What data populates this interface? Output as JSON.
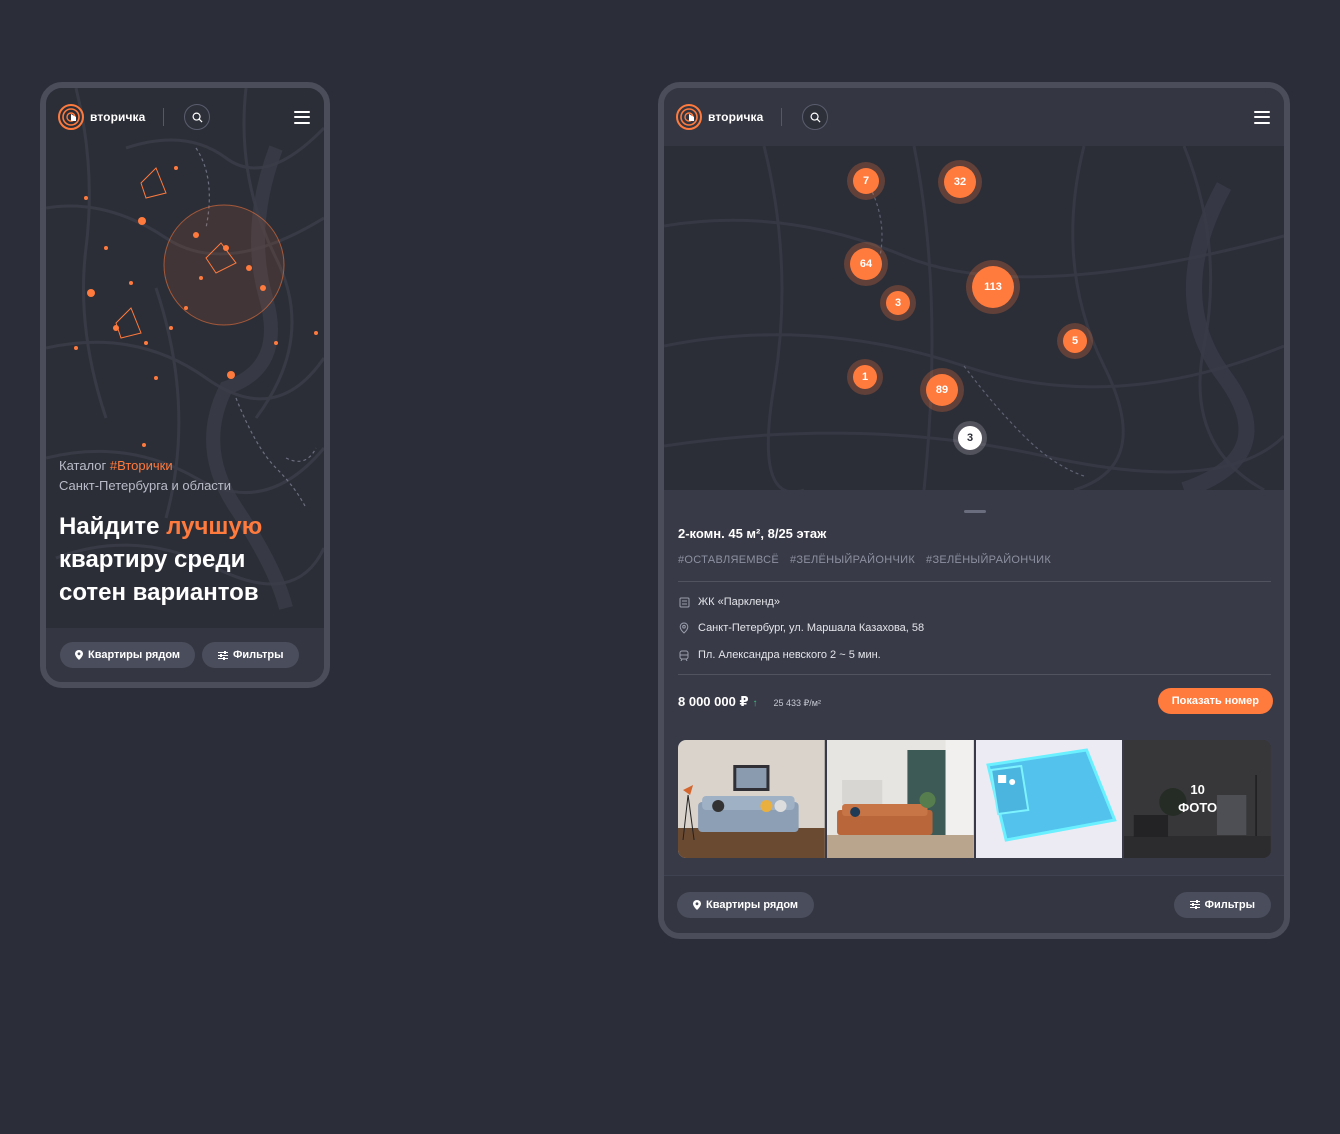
{
  "brand": {
    "name": "вторичка",
    "accent": "#ff7a3d"
  },
  "left_screen": {
    "hero_sub_prefix": "Каталог ",
    "hero_sub_accent": "#Вторички",
    "hero_sub_line2": "Санкт-Петербурга и области",
    "hero_title_pre": "Найдите ",
    "hero_title_accent": "лучшую",
    "hero_title_line2": "квартиру среди",
    "hero_title_line3": "сотен вариантов",
    "btn_nearby": "Квартиры рядом",
    "btn_filters": "Фильтры"
  },
  "right_screen": {
    "clusters": [
      {
        "label": "7"
      },
      {
        "label": "32"
      },
      {
        "label": "64"
      },
      {
        "label": "3"
      },
      {
        "label": "113"
      },
      {
        "label": "5"
      },
      {
        "label": "1"
      },
      {
        "label": "89"
      },
      {
        "label": "3"
      }
    ],
    "listing": {
      "title": "2-комн. 45 м², 8/25 этаж",
      "tags": [
        "#ОСТАВЛЯЕМВСЁ",
        "#ЗЕЛЁНЫЙРАЙОНЧИК",
        "#ЗЕЛЁНЫЙРАЙОНЧИК"
      ],
      "complex": "ЖК «Паркленд»",
      "address": "Санкт-Петербург, ул. Маршала Казахова, 58",
      "metro": "Пл. Александра невского 2 ~ 5 мин.",
      "price": "8 000 000 ₽",
      "price_per_m2": "25 433 ₽/м²",
      "show_number": "Показать номер",
      "photos_more_count": "10",
      "photos_more_label": "ФОТО"
    },
    "btn_nearby": "Квартиры рядом",
    "btn_filters": "Фильтры"
  },
  "icons": {
    "logo": "logo-icon",
    "search": "search-icon",
    "menu": "menu-icon",
    "pin": "pin-icon",
    "filter": "filter-icon",
    "building": "building-icon",
    "location": "location-icon",
    "metro": "metro-icon",
    "price_trend": "arrow-up-icon"
  }
}
